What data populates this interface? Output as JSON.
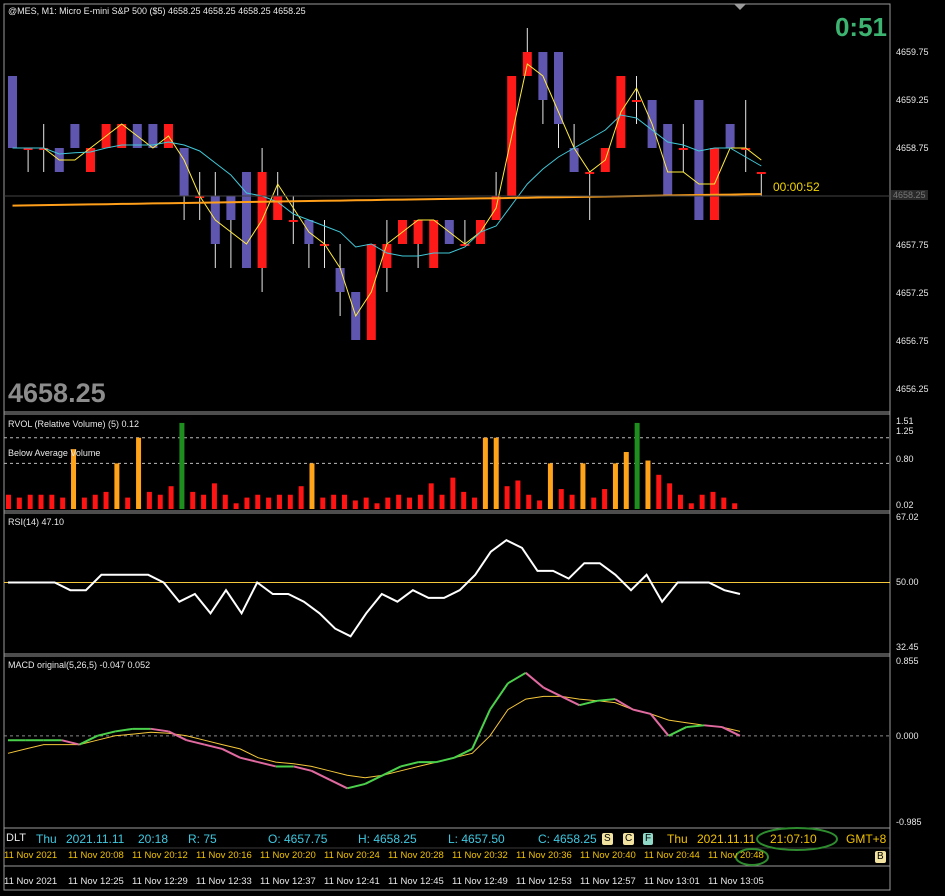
{
  "header": {
    "title": "@MES, M1:  Micro E-mini S&P 500 ($5)  4658.25 4658.25 4658.25 4658.25",
    "countdown": "0:51",
    "bar_timer": "00:00:52",
    "last_price_big": "4658.25",
    "price_tag": "4658.25"
  },
  "price_axis": [
    "4659.75",
    "4659.25",
    "4658.75",
    "4657.75",
    "4657.25",
    "4656.75",
    "4656.25"
  ],
  "rvol": {
    "title": "RVOL (Relative Volume) (5) 0.12",
    "label": "Below Average Volume",
    "axis": [
      "1.51",
      "1.25",
      "0.80",
      "0.02"
    ]
  },
  "rsi": {
    "title": "RSI(14) 47.10",
    "axis": [
      "67.02",
      "50.00",
      "32.45"
    ]
  },
  "macd": {
    "title": "MACD original(5,26,5) -0.047 0.052",
    "axis": [
      "0.855",
      "0.000",
      "-0.985"
    ]
  },
  "status_bar": {
    "dlt": "DLT",
    "day": "Thu",
    "date": "2021.11.11",
    "time": "20:18",
    "r": "R: 75",
    "o": "O: 4657.75",
    "h": "H: 4658.25",
    "l": "L: 4657.50",
    "c": "C: 4658.25",
    "badge_s": "S",
    "badge_c": "C",
    "badge_f": "F",
    "day2": "Thu",
    "date2": "2021.11.11",
    "time2": "21:07:10",
    "gmt": "GMT+8",
    "badge_b": "B"
  },
  "time_row_gmt8": [
    "11 Nov 2021",
    "11 Nov 20:08",
    "11 Nov 20:12",
    "11 Nov 20:16",
    "11 Nov 20:20",
    "11 Nov 20:24",
    "11 Nov 20:28",
    "11 Nov 20:32",
    "11 Nov 20:36",
    "11 Nov 20:40",
    "11 Nov 20:44",
    "11 Nov 20:48"
  ],
  "time_axis": [
    "11 Nov 2021",
    "11 Nov 12:25",
    "11 Nov 12:29",
    "11 Nov 12:33",
    "11 Nov 12:37",
    "11 Nov 12:41",
    "11 Nov 12:45",
    "11 Nov 12:49",
    "11 Nov 12:53",
    "11 Nov 12:57",
    "11 Nov 13:01",
    "11 Nov 13:05"
  ],
  "colors": {
    "bull": "#ff1a1a",
    "bear": "#5f56b0",
    "ma_fast": "#ffeb3b",
    "ma_mid": "#40c8d8",
    "ma_slow": "#ff9f1a",
    "rvol_red": "#ff1414",
    "rvol_orange": "#ffa31a",
    "rvol_green": "#1e8f1e",
    "macd_up": "#4cd14c",
    "macd_down": "#e06aa0",
    "signal": "#f5c73a"
  },
  "chart_data": {
    "type": "candlestick",
    "candles": [
      {
        "o": 4659.5,
        "h": 4659.5,
        "l": 4658.75,
        "c": 4658.75
      },
      {
        "o": 4658.75,
        "h": 4658.75,
        "l": 4658.5,
        "c": 4658.75
      },
      {
        "o": 4658.75,
        "h": 4659.0,
        "l": 4658.5,
        "c": 4658.75
      },
      {
        "o": 4658.75,
        "h": 4658.75,
        "l": 4658.5,
        "c": 4658.5
      },
      {
        "o": 4659.0,
        "h": 4659.0,
        "l": 4658.75,
        "c": 4658.75
      },
      {
        "o": 4658.5,
        "h": 4658.75,
        "l": 4658.5,
        "c": 4658.75
      },
      {
        "o": 4658.75,
        "h": 4659.0,
        "l": 4658.75,
        "c": 4659.0
      },
      {
        "o": 4658.75,
        "h": 4659.0,
        "l": 4658.75,
        "c": 4659.0
      },
      {
        "o": 4659.0,
        "h": 4659.0,
        "l": 4658.75,
        "c": 4658.75
      },
      {
        "o": 4659.0,
        "h": 4659.0,
        "l": 4658.75,
        "c": 4658.75
      },
      {
        "o": 4658.75,
        "h": 4659.0,
        "l": 4658.75,
        "c": 4659.0
      },
      {
        "o": 4658.75,
        "h": 4658.75,
        "l": 4658.0,
        "c": 4658.25
      },
      {
        "o": 4658.25,
        "h": 4658.5,
        "l": 4658.0,
        "c": 4658.25
      },
      {
        "o": 4658.25,
        "h": 4658.5,
        "l": 4657.5,
        "c": 4657.75
      },
      {
        "o": 4658.25,
        "h": 4658.25,
        "l": 4657.5,
        "c": 4658.0
      },
      {
        "o": 4658.5,
        "h": 4658.5,
        "l": 4657.5,
        "c": 4657.5
      },
      {
        "o": 4657.5,
        "h": 4658.75,
        "l": 4657.25,
        "c": 4658.5
      },
      {
        "o": 4658.0,
        "h": 4658.5,
        "l": 4658.0,
        "c": 4658.25
      },
      {
        "o": 4658.0,
        "h": 4658.25,
        "l": 4657.75,
        "c": 4658.0
      },
      {
        "o": 4658.0,
        "h": 4658.0,
        "l": 4657.5,
        "c": 4657.75
      },
      {
        "o": 4657.75,
        "h": 4658.0,
        "l": 4657.5,
        "c": 4657.75
      },
      {
        "o": 4657.5,
        "h": 4657.75,
        "l": 4657.0,
        "c": 4657.25
      },
      {
        "o": 4657.25,
        "h": 4657.25,
        "l": 4656.75,
        "c": 4656.75
      },
      {
        "o": 4656.75,
        "h": 4657.75,
        "l": 4656.75,
        "c": 4657.75
      },
      {
        "o": 4657.5,
        "h": 4658.0,
        "l": 4657.25,
        "c": 4657.75
      },
      {
        "o": 4657.75,
        "h": 4658.0,
        "l": 4657.75,
        "c": 4658.0
      },
      {
        "o": 4657.75,
        "h": 4658.0,
        "l": 4657.5,
        "c": 4658.0
      },
      {
        "o": 4657.5,
        "h": 4658.0,
        "l": 4657.5,
        "c": 4658.0
      },
      {
        "o": 4658.0,
        "h": 4658.0,
        "l": 4657.75,
        "c": 4657.75
      },
      {
        "o": 4657.75,
        "h": 4658.0,
        "l": 4657.75,
        "c": 4657.75
      },
      {
        "o": 4657.75,
        "h": 4658.0,
        "l": 4657.75,
        "c": 4658.0
      },
      {
        "o": 4658.0,
        "h": 4658.5,
        "l": 4658.0,
        "c": 4658.25
      },
      {
        "o": 4658.25,
        "h": 4659.0,
        "l": 4658.25,
        "c": 4659.5
      },
      {
        "o": 4659.5,
        "h": 4660.0,
        "l": 4659.5,
        "c": 4659.75
      },
      {
        "o": 4659.75,
        "h": 4659.75,
        "l": 4659.0,
        "c": 4659.25
      },
      {
        "o": 4659.75,
        "h": 4659.75,
        "l": 4658.75,
        "c": 4659.0
      },
      {
        "o": 4658.75,
        "h": 4659.0,
        "l": 4658.5,
        "c": 4658.5
      },
      {
        "o": 4658.5,
        "h": 4658.5,
        "l": 4658.0,
        "c": 4658.5
      },
      {
        "o": 4658.5,
        "h": 4658.75,
        "l": 4658.5,
        "c": 4658.75
      },
      {
        "o": 4658.75,
        "h": 4659.5,
        "l": 4658.75,
        "c": 4659.5
      },
      {
        "o": 4659.25,
        "h": 4659.5,
        "l": 4659.0,
        "c": 4659.25
      },
      {
        "o": 4659.25,
        "h": 4659.25,
        "l": 4658.75,
        "c": 4658.75
      },
      {
        "o": 4659.0,
        "h": 4659.0,
        "l": 4658.25,
        "c": 4658.25
      },
      {
        "o": 4658.75,
        "h": 4659.0,
        "l": 4658.5,
        "c": 4658.75
      },
      {
        "o": 4659.25,
        "h": 4659.25,
        "l": 4658.25,
        "c": 4658.0
      },
      {
        "o": 4658.0,
        "h": 4658.75,
        "l": 4658.0,
        "c": 4658.75
      },
      {
        "o": 4659.0,
        "h": 4659.0,
        "l": 4658.75,
        "c": 4658.75
      },
      {
        "o": 4658.75,
        "h": 4659.25,
        "l": 4658.5,
        "c": 4658.75
      },
      {
        "o": 4658.5,
        "h": 4658.5,
        "l": 4658.25,
        "c": 4658.5
      }
    ],
    "rvol": [
      0.25,
      0.2,
      0.25,
      0.25,
      0.25,
      0.2,
      1.05,
      0.2,
      0.25,
      0.3,
      0.8,
      0.2,
      1.25,
      0.3,
      0.25,
      0.4,
      1.51,
      0.3,
      0.25,
      0.45,
      0.25,
      0.1,
      0.2,
      0.25,
      0.2,
      0.25,
      0.25,
      0.4,
      0.8,
      0.2,
      0.25,
      0.25,
      0.15,
      0.2,
      0.1,
      0.2,
      0.25,
      0.2,
      0.25,
      0.45,
      0.25,
      0.55,
      0.3,
      0.2,
      1.25,
      1.25,
      0.4,
      0.5,
      0.25,
      0.15,
      0.8,
      0.35,
      0.25,
      0.8,
      0.2,
      0.35,
      0.8,
      1.0,
      1.51,
      0.85,
      0.6,
      0.45,
      0.25,
      0.1,
      0.25,
      0.3,
      0.2,
      0.1
    ],
    "rsi": [
      50,
      50,
      50,
      50,
      48,
      48,
      52,
      52,
      52,
      52,
      50,
      45,
      47,
      42,
      48,
      42,
      50,
      47,
      47,
      45,
      42,
      38,
      36,
      42,
      47,
      45,
      48,
      46,
      46,
      48,
      52,
      58,
      61,
      59,
      53,
      53,
      51,
      55,
      55,
      52,
      48,
      52,
      45,
      50,
      50,
      50,
      48,
      47
    ],
    "macd": [
      -0.05,
      -0.05,
      -0.05,
      -0.05,
      -0.1,
      0.0,
      0.05,
      0.08,
      0.08,
      0.05,
      -0.05,
      -0.1,
      -0.15,
      -0.25,
      -0.3,
      -0.35,
      -0.35,
      -0.4,
      -0.5,
      -0.6,
      -0.55,
      -0.45,
      -0.35,
      -0.3,
      -0.3,
      -0.25,
      -0.15,
      0.3,
      0.6,
      0.72,
      0.55,
      0.45,
      0.35,
      0.4,
      0.42,
      0.3,
      0.25,
      0.0,
      0.1,
      0.12,
      0.1,
      0.0
    ],
    "signal": [
      -0.2,
      -0.15,
      -0.1,
      -0.1,
      -0.1,
      -0.05,
      0.0,
      0.02,
      0.04,
      0.03,
      0.0,
      -0.05,
      -0.1,
      -0.15,
      -0.25,
      -0.3,
      -0.32,
      -0.35,
      -0.4,
      -0.45,
      -0.48,
      -0.45,
      -0.4,
      -0.35,
      -0.3,
      -0.25,
      -0.2,
      0.0,
      0.3,
      0.42,
      0.45,
      0.45,
      0.42,
      0.4,
      0.38,
      0.3,
      0.25,
      0.18,
      0.15,
      0.12,
      0.1,
      0.05
    ]
  }
}
